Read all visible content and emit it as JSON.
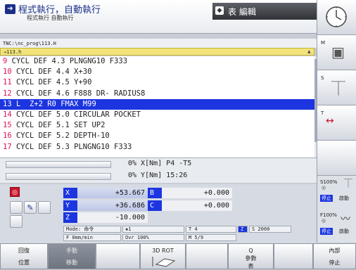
{
  "header": {
    "mode_title": "程式執行，自動執行",
    "mode_subtitle": "程式執行 自動執行",
    "edit_tab_label": "表 編輯"
  },
  "program": {
    "path": "TNC:\\nc_prog\\113.H",
    "file_marker": "→113.h",
    "lines": [
      {
        "num": "9",
        "text": " CYCL DEF 4.3 PLNGNG10 F333",
        "active": false
      },
      {
        "num": "10",
        "text": " CYCL DEF 4.4 X+30",
        "active": false
      },
      {
        "num": "11",
        "text": " CYCL DEF 4.5 Y+90",
        "active": false
      },
      {
        "num": "12",
        "text": " CYCL DEF 4.6 F888 DR- RADIUS8",
        "active": false
      },
      {
        "num": "13",
        "text": " L  Z+2 R0 FMAX M99",
        "active": true
      },
      {
        "num": "14",
        "text": " CYCL DEF 5.0 CIRCULAR POCKET",
        "active": false
      },
      {
        "num": "15",
        "text": " CYCL DEF 5.1 SET UP2",
        "active": false
      },
      {
        "num": "16",
        "text": " CYCL DEF 5.2 DEPTH-10",
        "active": false
      },
      {
        "num": "17",
        "text": " CYCL DEF 5.3 PLNGNG10 F333",
        "active": false
      }
    ]
  },
  "status": {
    "row1": "0% X[Nm] P4  -T5",
    "row2": "0% Y[Nm] 15:26"
  },
  "position": {
    "axes": [
      {
        "label": "X",
        "value": "+53.667"
      },
      {
        "label": "Y",
        "value": "+36.686"
      },
      {
        "label": "Z",
        "value": "-10.000"
      }
    ],
    "aux_axes": [
      {
        "label": "B",
        "value": "+0.000"
      },
      {
        "label": "C",
        "value": "+0.000"
      }
    ],
    "mode_label": "Mode: 命令",
    "feed": "F 0mm/min",
    "tool_index": "1",
    "override": "Ovr 100%",
    "tool": "T 4",
    "tool_axis": "Z",
    "spindle": "S 2000",
    "mfunc": "M 5/9"
  },
  "side_panel": {
    "m_label": "M",
    "s_label": "S",
    "t_label": "T",
    "s_override": "S100%",
    "f_override": "F100%",
    "stop_label": "停止",
    "start_label": "啟動"
  },
  "softkeys": [
    {
      "line1": "回復",
      "line2": "位置",
      "style": "normal"
    },
    {
      "line1": "手動",
      "line2": "移動",
      "style": "dark"
    },
    {
      "line1": "",
      "line2": "",
      "style": "normal"
    },
    {
      "line1": "3D ROT",
      "line2": "",
      "style": "normal"
    },
    {
      "line1": "",
      "line2": "",
      "style": "disabled"
    },
    {
      "line1": "Q",
      "line2": "參數",
      "line3": "表",
      "style": "normal"
    },
    {
      "line1": "",
      "line2": "",
      "style": "disabled"
    },
    {
      "line1": "內部",
      "line2": "停止",
      "style": "normal"
    }
  ]
}
